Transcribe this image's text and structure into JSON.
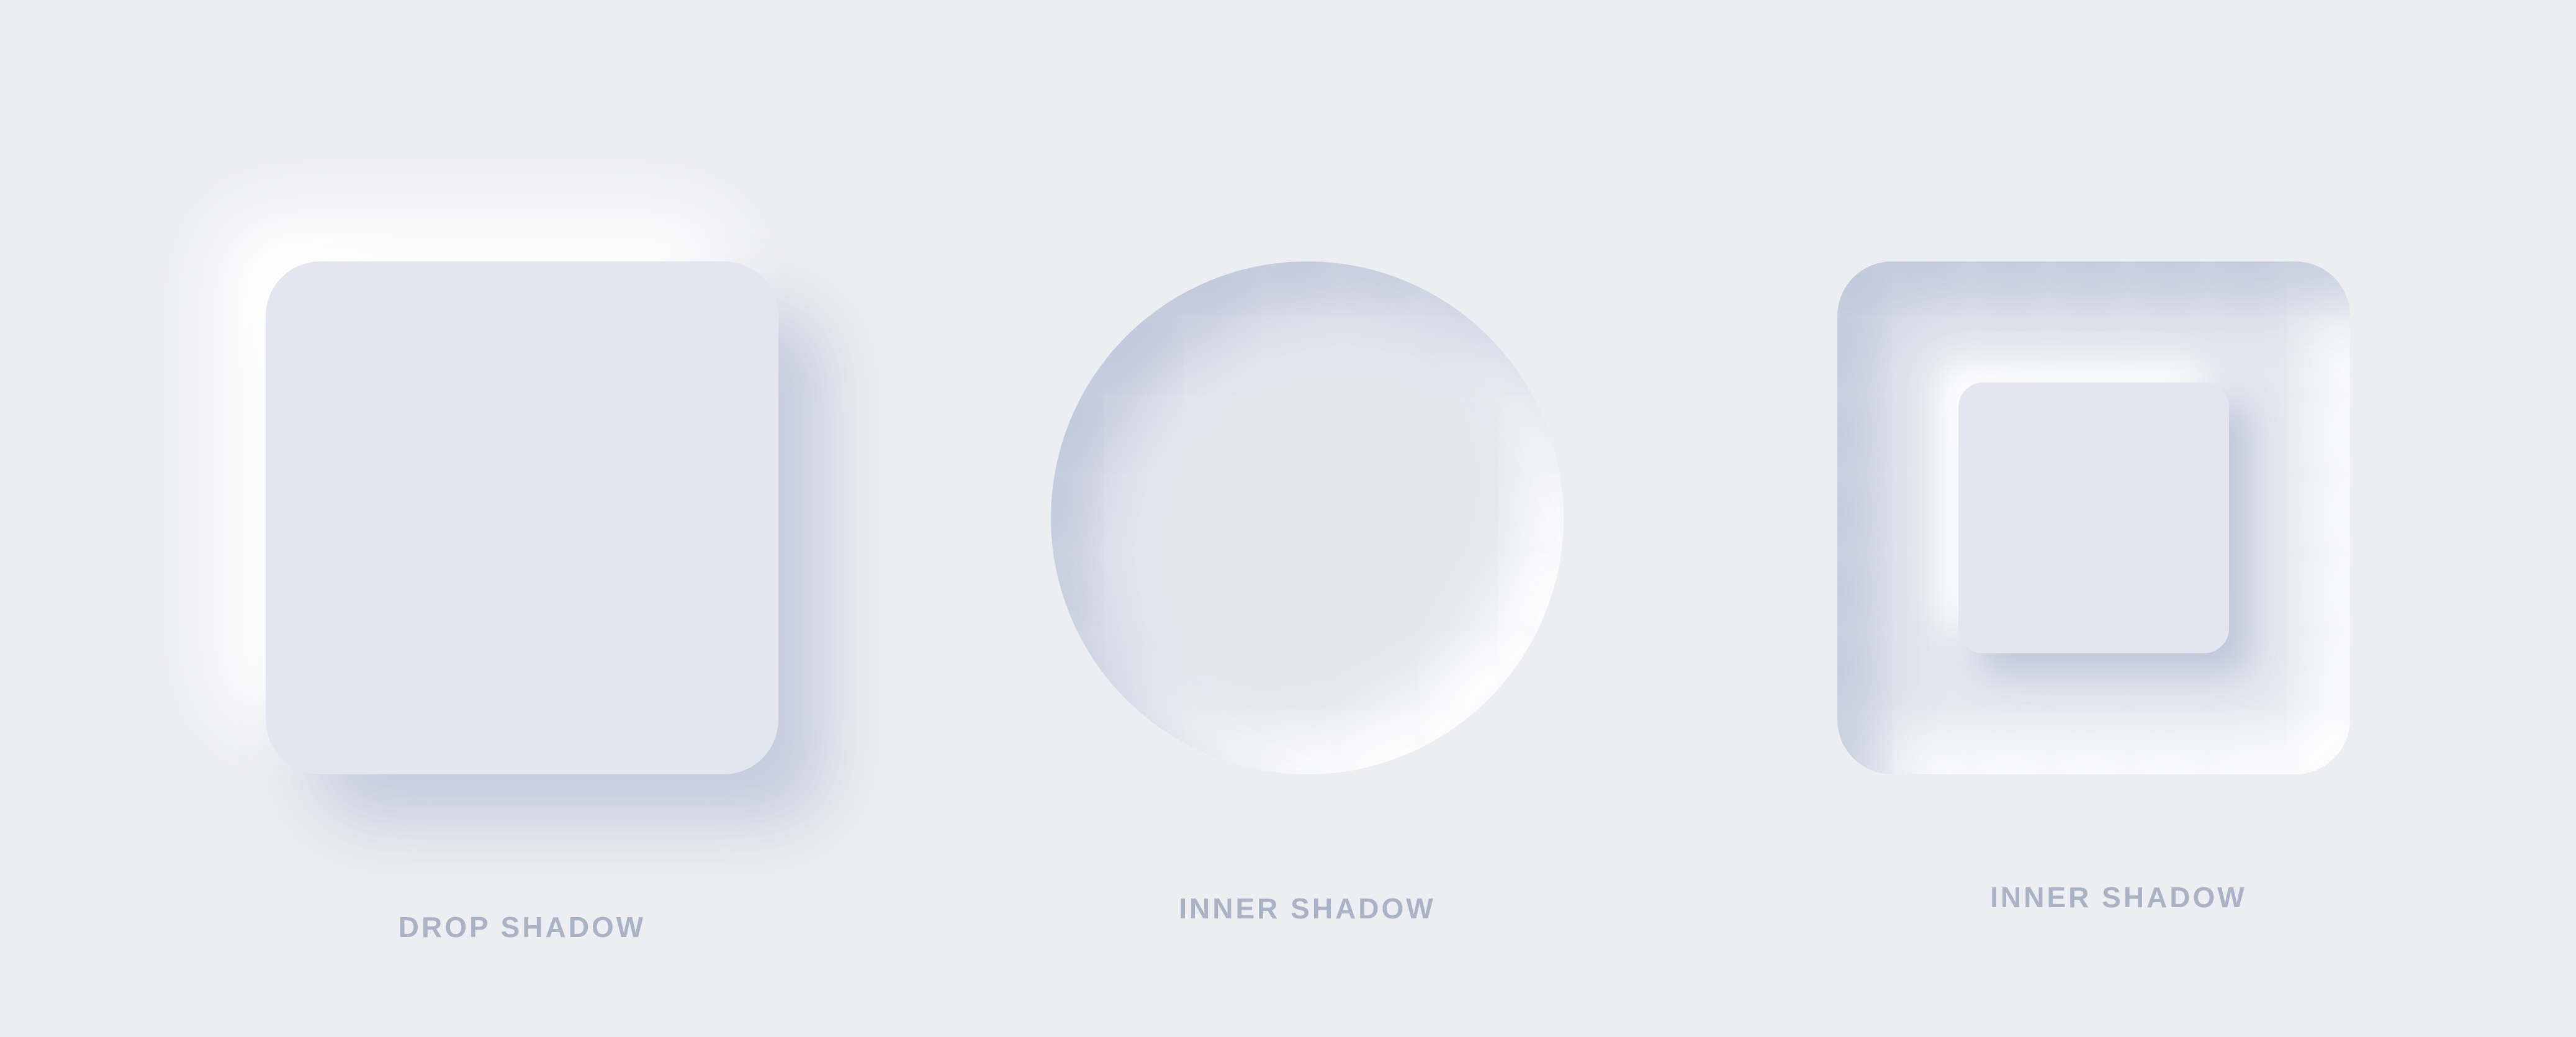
{
  "colors": {
    "background": "#edeef2",
    "surface": "#e3e6ee",
    "shadow_dark": "#b8c2d6",
    "shadow_light": "#ffffff",
    "label_text": "#aab2c6"
  },
  "cards": [
    {
      "shape": "rounded-square",
      "effect": "drop shadow",
      "label": "DROP SHADOW"
    },
    {
      "shape": "circle",
      "effect": "inner shadow",
      "label": "INNER SHADOW"
    },
    {
      "shape": "rounded-square-with-raised-inner-square",
      "effect": "inner shadow",
      "label": "INNER SHADOW"
    }
  ]
}
